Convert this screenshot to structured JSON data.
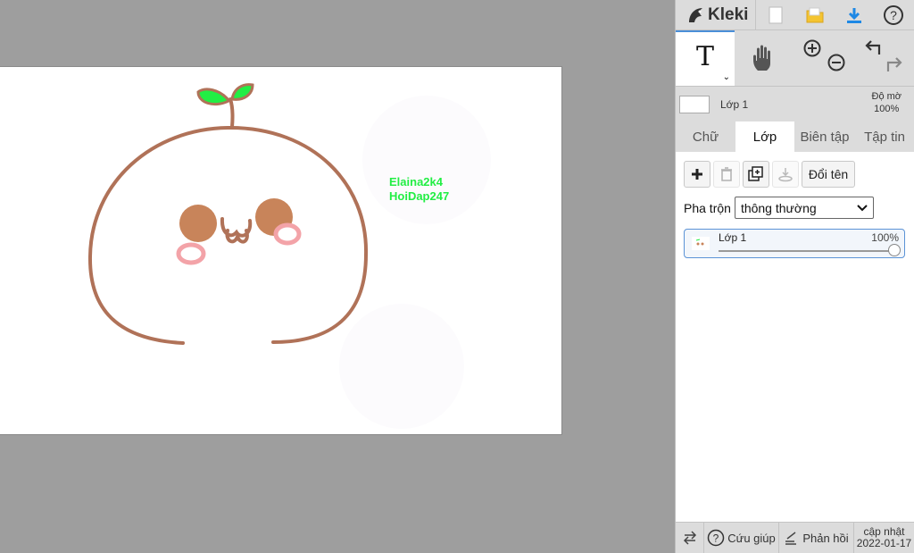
{
  "canvas": {
    "watermark_line1": "Elaina2k4",
    "watermark_line2": "HoiDap247",
    "colors": {
      "outline": "#b07258",
      "cheek": "#c8845a",
      "blush": "#f3a3a8",
      "leaf": "#22ee44",
      "text": "#22ee44"
    }
  },
  "app": {
    "title": "Kleki"
  },
  "toolbar": {
    "text_tool": "T"
  },
  "layer_bar": {
    "name": "Lớp 1",
    "opacity_label": "Độ mờ",
    "opacity_value": "100%"
  },
  "tabs": [
    {
      "label": "Chữ",
      "active": false
    },
    {
      "label": "Lớp",
      "active": true
    },
    {
      "label": "Biên tập",
      "active": false
    },
    {
      "label": "Tập tin",
      "active": false
    }
  ],
  "layers_panel": {
    "rename_label": "Đổi tên",
    "blend_label": "Pha trộn",
    "blend_value": "thông thường",
    "layer": {
      "name": "Lớp 1",
      "opacity": "100%"
    }
  },
  "footer": {
    "help_label": "Cứu giúp",
    "feedback_label": "Phản hồi",
    "update_label": "cập nhật",
    "update_date": "2022-01-17"
  }
}
